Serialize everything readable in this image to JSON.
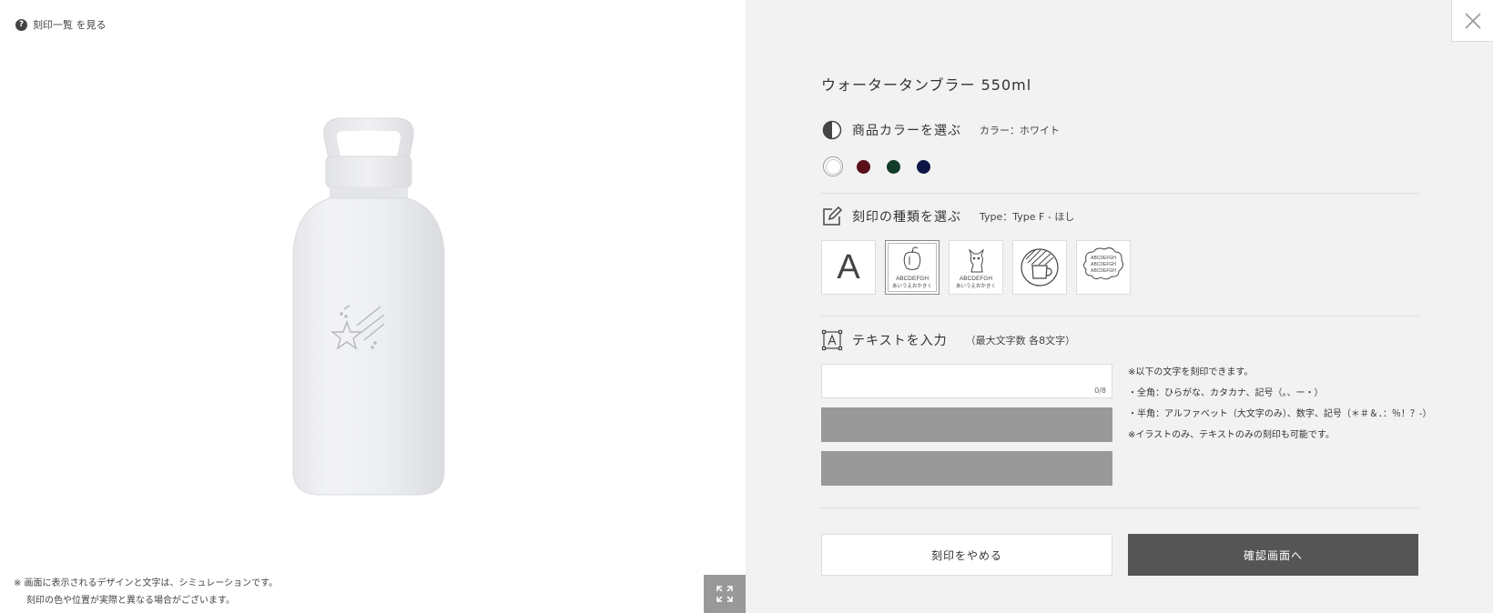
{
  "help_link": {
    "icon": "question-icon",
    "label": "刻印一覧 を見る"
  },
  "simulation_note": {
    "line1": "※ 画面に表示されるデザインと文字は、シミュレーションです。",
    "line2": "刻印の色や位置が実際と異なる場合がございます。"
  },
  "product": {
    "title": "ウォータータンブラー 550ml"
  },
  "color_section": {
    "label": "商品カラーを選ぶ",
    "current": "カラー：ホワイト",
    "icon": "half-circle-icon",
    "swatches": [
      {
        "name": "white",
        "color": "#ffffff",
        "selected": true
      },
      {
        "name": "burgundy",
        "color": "#5a0f1a",
        "selected": false
      },
      {
        "name": "green",
        "color": "#123d2a",
        "selected": false
      },
      {
        "name": "navy",
        "color": "#0e1646",
        "selected": false
      }
    ]
  },
  "type_section": {
    "label": "刻印の種類を選ぶ",
    "current": "Type：Type F - ほし",
    "icon": "pencil-square-icon",
    "cards": [
      {
        "name": "type-text",
        "glyph": "A",
        "selected": false
      },
      {
        "name": "type-apple",
        "text1": "ABCDEFGH",
        "text2": "あいうえおかきく",
        "selected": true
      },
      {
        "name": "type-dog",
        "text1": "ABCDEFGH",
        "text2": "あいうえおかきく",
        "selected": false
      },
      {
        "name": "type-cup",
        "selected": false
      },
      {
        "name": "type-cloud",
        "text1": "ABCDEFGH",
        "text2": "ABCDEFGH",
        "text3": "ABCDEFGH",
        "selected": false
      }
    ]
  },
  "text_section": {
    "label": "テキストを入力",
    "sub": "（最大文字数 各8文字）",
    "icon": "text-box-icon",
    "counter": "0/8",
    "notes": [
      "※以下の文字を刻印できます。",
      "・全角：ひらがな、カタカナ、記号（。、ー・）",
      "・半角：アルファベット（大文字のみ）、数字、記号（＊＃＆．：％！？-）",
      "※イラストのみ、テキストのみの刻印も可能です。"
    ]
  },
  "actions": {
    "cancel": "刻印をやめる",
    "confirm": "確認画面へ"
  },
  "icons": {
    "close": "close-icon",
    "expand": "expand-icon"
  }
}
